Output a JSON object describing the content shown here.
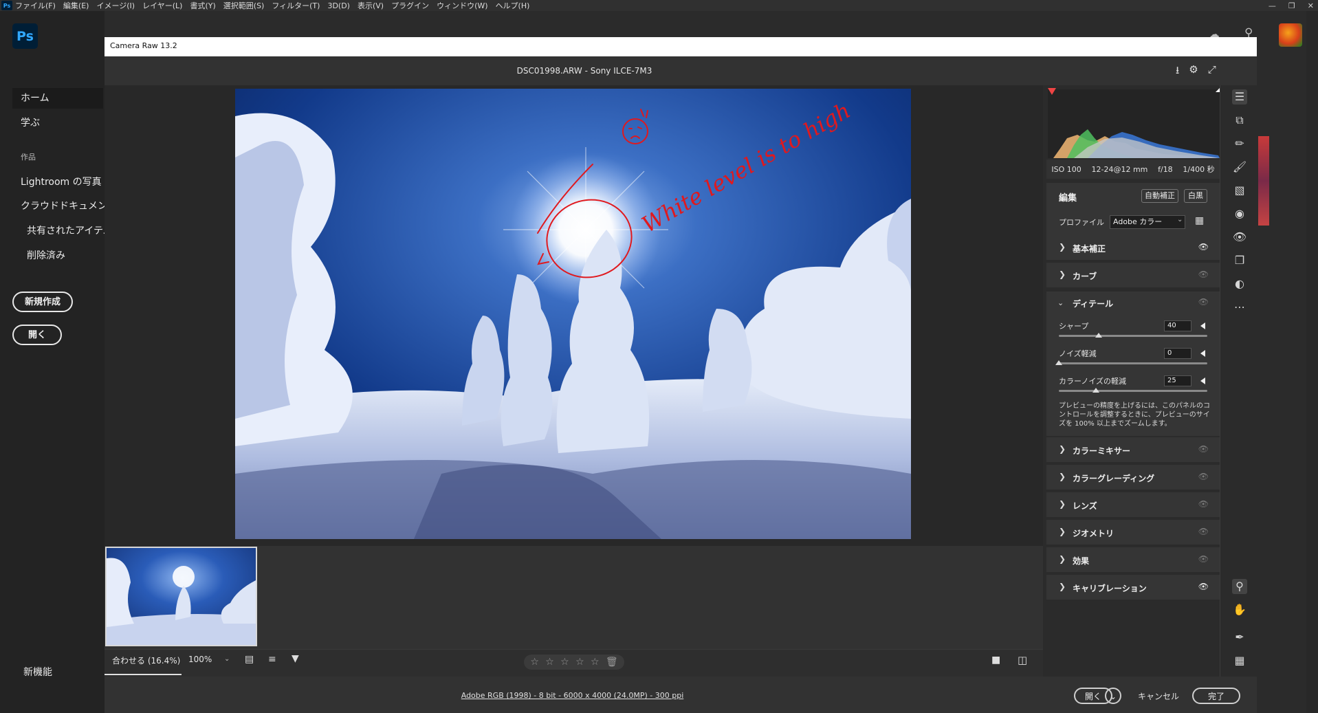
{
  "menubar": {
    "items": [
      "ファイル(F)",
      "編集(E)",
      "イメージ(I)",
      "レイヤー(L)",
      "書式(Y)",
      "選択範囲(S)",
      "フィルター(T)",
      "3D(D)",
      "表示(V)",
      "プラグイン",
      "ウィンドウ(W)",
      "ヘルプ(H)"
    ],
    "app_logo": "Ps"
  },
  "ps_home": {
    "logo": "Ps",
    "nav": [
      "ホーム",
      "学ぶ"
    ],
    "section_label": "作品",
    "work_items": [
      "Lightroom の写真",
      "クラウドドキュメント",
      "共有されたアイテム",
      "削除済み"
    ],
    "new_button": "新規作成",
    "open_button": "開く",
    "whats_new": "新機能"
  },
  "dialog": {
    "title": "Camera Raw 13.2",
    "file_title": "DSC01998.ARW  -  Sony ILCE-7M3",
    "annotation_text": "White level is to high"
  },
  "histogram": {
    "exif": [
      "ISO 100",
      "12-24@12 mm",
      "f/18",
      "1/400 秒"
    ]
  },
  "edit": {
    "title": "編集",
    "auto_button": "自動補正",
    "bw_button": "白黒",
    "profile_label": "プロファイル",
    "profile_value": "Adobe カラー",
    "sections_top": [
      {
        "label": "基本補正",
        "eye_on": true
      },
      {
        "label": "カーブ",
        "eye_on": false
      }
    ],
    "detail": {
      "label": "ディテール",
      "sliders": [
        {
          "label": "シャープ",
          "value": "40",
          "fraction": 0.27
        },
        {
          "label": "ノイズ軽減",
          "value": "0",
          "fraction": 0.0
        },
        {
          "label": "カラーノイズの軽減",
          "value": "25",
          "fraction": 0.25
        }
      ],
      "note": "プレビューの精度を上げるには、このパネルのコントロールを調整するときに、プレビューのサイズを 100% 以上までズームします。"
    },
    "sections_bottom": [
      {
        "label": "カラーミキサー",
        "eye_on": false
      },
      {
        "label": "カラーグレーディング",
        "eye_on": false
      },
      {
        "label": "レンズ",
        "eye_on": false
      },
      {
        "label": "ジオメトリ",
        "eye_on": false
      },
      {
        "label": "効果",
        "eye_on": false
      },
      {
        "label": "キャリブレーション",
        "eye_on": true
      }
    ]
  },
  "bottombar": {
    "fit_label": "合わせる (16.4%)",
    "zoom_label": "100%",
    "stars": [
      "☆",
      "☆",
      "☆",
      "☆",
      "☆"
    ]
  },
  "footer": {
    "info": "Adobe RGB (1998) - 8 bit - 6000 x 4000 (24.0MP) - 300 ppi",
    "open_button": "開く",
    "cancel_button": "キャンセル",
    "done_button": "完了"
  },
  "colors": {
    "accent": "#31a8ff",
    "annotation": "#e0191e",
    "sky_dark": "#0a1f5c",
    "sky_light": "#3c6fc4"
  }
}
